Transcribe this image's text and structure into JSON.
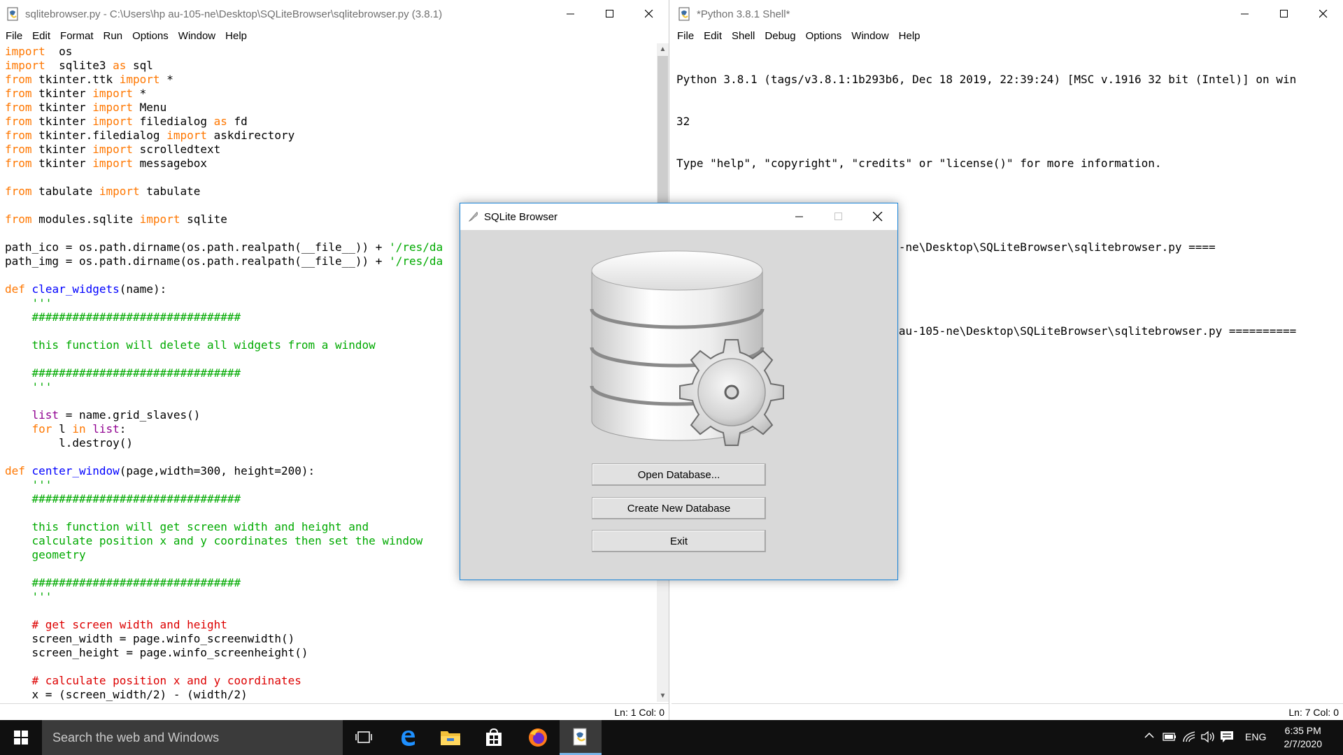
{
  "editor": {
    "title": "sqlitebrowser.py - C:\\Users\\hp au-105-ne\\Desktop\\SQLiteBrowser\\sqlitebrowser.py (3.8.1)",
    "menu": [
      "File",
      "Edit",
      "Format",
      "Run",
      "Options",
      "Window",
      "Help"
    ],
    "status": "Ln: 1   Col: 0"
  },
  "shell": {
    "title": "*Python 3.8.1 Shell*",
    "menu": [
      "File",
      "Edit",
      "Shell",
      "Debug",
      "Options",
      "Window",
      "Help"
    ],
    "status": "Ln: 7   Col: 0",
    "lines": [
      "Python 3.8.1 (tags/v3.8.1:1b293b6, Dec 18 2019, 22:39:24) [MSC v.1916 32 bit (Intel)] on win",
      "32",
      "Type \"help\", \"copyright\", \"credits\" or \"license()\" for more information.",
      ">>> ",
      "===== RESTART: C:\\Users\\hp au-105-ne\\Desktop\\SQLiteBrowser\\sqlitebrowser.py ====",
      ">>> ",
      "=========== RESTART: C:\\Users\\hp au-105-ne\\Desktop\\SQLiteBrowser\\sqlitebrowser.py =========="
    ]
  },
  "dialog": {
    "title": "SQLite Browser",
    "buttons": {
      "open": "Open Database...",
      "create": "Create New Database",
      "exit": "Exit"
    }
  },
  "taskbar": {
    "search_placeholder": "Search the web and Windows",
    "language": "ENG",
    "time": "6:35 PM",
    "date": "2/7/2020"
  },
  "code_lines": [
    [
      [
        "kw",
        "import"
      ],
      [
        "",
        "  os"
      ]
    ],
    [
      [
        "kw",
        "import"
      ],
      [
        "",
        "  sqlite3 "
      ],
      [
        "kw",
        "as"
      ],
      [
        "",
        " sql"
      ]
    ],
    [
      [
        "kw",
        "from"
      ],
      [
        "",
        " tkinter.ttk "
      ],
      [
        "kw",
        "import"
      ],
      [
        "",
        " *"
      ]
    ],
    [
      [
        "kw",
        "from"
      ],
      [
        "",
        " tkinter "
      ],
      [
        "kw",
        "import"
      ],
      [
        "",
        " *"
      ]
    ],
    [
      [
        "kw",
        "from"
      ],
      [
        "",
        " tkinter "
      ],
      [
        "kw",
        "import"
      ],
      [
        "",
        " Menu"
      ]
    ],
    [
      [
        "kw",
        "from"
      ],
      [
        "",
        " tkinter "
      ],
      [
        "kw",
        "import"
      ],
      [
        "",
        " filedialog "
      ],
      [
        "kw",
        "as"
      ],
      [
        "",
        " fd"
      ]
    ],
    [
      [
        "kw",
        "from"
      ],
      [
        "",
        " tkinter.filedialog "
      ],
      [
        "kw",
        "import"
      ],
      [
        "",
        " askdirectory"
      ]
    ],
    [
      [
        "kw",
        "from"
      ],
      [
        "",
        " tkinter "
      ],
      [
        "kw",
        "import"
      ],
      [
        "",
        " scrolledtext"
      ]
    ],
    [
      [
        "kw",
        "from"
      ],
      [
        "",
        " tkinter "
      ],
      [
        "kw",
        "import"
      ],
      [
        "",
        " messagebox"
      ]
    ],
    [],
    [
      [
        "kw",
        "from"
      ],
      [
        "",
        " tabulate "
      ],
      [
        "kw",
        "import"
      ],
      [
        "",
        " tabulate"
      ]
    ],
    [],
    [
      [
        "kw",
        "from"
      ],
      [
        "",
        " modules.sqlite "
      ],
      [
        "kw",
        "import"
      ],
      [
        "",
        " sqlite"
      ]
    ],
    [],
    [
      [
        "",
        "path_ico = os.path.dirname(os.path.realpath(__file__)) + "
      ],
      [
        "str",
        "'/res/da"
      ]
    ],
    [
      [
        "",
        "path_img = os.path.dirname(os.path.realpath(__file__)) + "
      ],
      [
        "str",
        "'/res/da"
      ]
    ],
    [],
    [
      [
        "kw",
        "def"
      ],
      [
        "",
        " "
      ],
      [
        "def",
        "clear_widgets"
      ],
      [
        "",
        "(name):"
      ]
    ],
    [
      [
        "str",
        "    '''"
      ]
    ],
    [
      [
        "str",
        "    ###############################"
      ]
    ],
    [],
    [
      [
        "str",
        "    this function will delete all widgets from a window"
      ]
    ],
    [],
    [
      [
        "str",
        "    ###############################"
      ]
    ],
    [
      [
        "str",
        "    '''"
      ]
    ],
    [],
    [
      [
        "bi",
        "    list"
      ],
      [
        "",
        " = name.grid_slaves()"
      ]
    ],
    [
      [
        "kw",
        "    for"
      ],
      [
        "",
        " l "
      ],
      [
        "kw",
        "in"
      ],
      [
        "",
        " "
      ],
      [
        "bi",
        "list"
      ],
      [
        "",
        ":"
      ]
    ],
    [
      [
        "",
        "        l.destroy()"
      ]
    ],
    [],
    [
      [
        "kw",
        "def"
      ],
      [
        "",
        " "
      ],
      [
        "def",
        "center_window"
      ],
      [
        "",
        "(page,width=300, height=200):"
      ]
    ],
    [
      [
        "str",
        "    '''"
      ]
    ],
    [
      [
        "str",
        "    ###############################"
      ]
    ],
    [],
    [
      [
        "str",
        "    this function will get screen width and height and"
      ]
    ],
    [
      [
        "str",
        "    calculate position x and y coordinates then set the window"
      ]
    ],
    [
      [
        "str",
        "    geometry"
      ]
    ],
    [],
    [
      [
        "str",
        "    ###############################"
      ]
    ],
    [
      [
        "str",
        "    '''"
      ]
    ],
    [],
    [
      [
        "com",
        "    # get screen width and height"
      ]
    ],
    [
      [
        "",
        "    screen_width = page.winfo_screenwidth()"
      ]
    ],
    [
      [
        "",
        "    screen_height = page.winfo_screenheight()"
      ]
    ],
    [],
    [
      [
        "com",
        "    # calculate position x and y coordinates"
      ]
    ],
    [
      [
        "",
        "    x = (screen_width/2) - (width/2)"
      ]
    ]
  ],
  "icons": {
    "idle_file": "python-file-icon",
    "dialog_app": "feather-icon",
    "start": "windows-logo-icon",
    "task_view": "task-view-icon",
    "edge": "edge-browser-icon",
    "explorer": "file-explorer-icon",
    "store": "store-icon",
    "firefox": "firefox-icon",
    "python": "python-idle-icon"
  }
}
